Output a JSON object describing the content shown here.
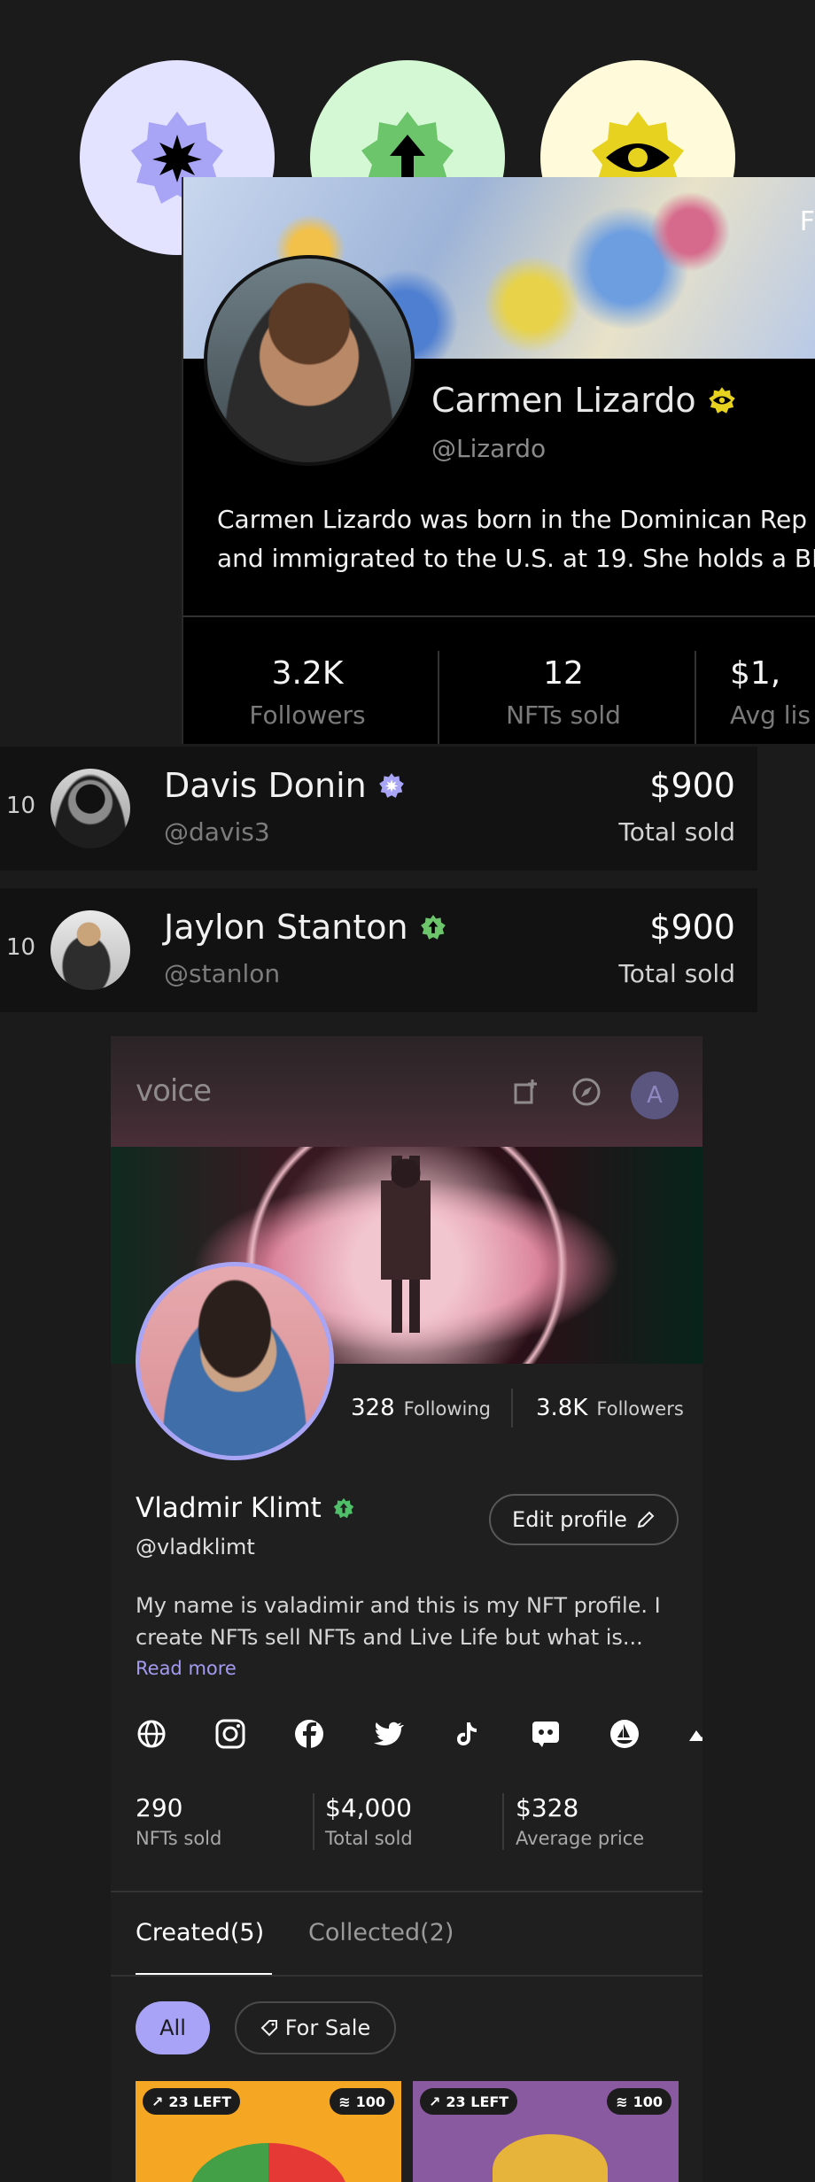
{
  "badges": [
    {
      "icon": "starburst-icon",
      "bg": "#e3e2ff",
      "fill": "#a9a5f6"
    },
    {
      "icon": "arrow-up-icon",
      "bg": "#d5f8d4",
      "fill": "#6cc46b"
    },
    {
      "icon": "eye-icon",
      "bg": "#fffad9",
      "fill": "#e6d21f"
    }
  ],
  "profile_card": {
    "name": "Carmen Lizardo",
    "handle": "@Lizardo",
    "bio_line1": "Carmen Lizardo was born in the Dominican Rep",
    "bio_line2": "and immigrated to the U.S. at 19. She holds a BF",
    "edge_text": "F",
    "stats": [
      {
        "value": "3.2K",
        "label": "Followers"
      },
      {
        "value": "12",
        "label": "NFTs sold"
      },
      {
        "value": "$1,",
        "label": "Avg lis"
      }
    ]
  },
  "leaderboard": [
    {
      "rank": "10",
      "name": "Davis Donin",
      "handle": "@davis3",
      "amount": "$900",
      "amount_label": "Total sold",
      "badge_color": "#a9a5f6"
    },
    {
      "rank": "10",
      "name": "Jaylon Stanton",
      "handle": "@stanlon",
      "amount": "$900",
      "amount_label": "Total sold",
      "badge_color": "#6cc46b"
    }
  ],
  "panel": {
    "logo": "voice",
    "avatar_letter": "A",
    "following_count": "328",
    "following_label": "Following",
    "followers_count": "3.8K",
    "followers_label": "Followers",
    "name": "Vladmir Klimt",
    "handle": "@vladklimt",
    "edit_label": "Edit profile",
    "bio_line1": "My name is valadimir and this is my NFT profile. I",
    "bio_line2": "create NFTs sell NFTs and Live Life but what is...",
    "read_more": "Read more",
    "socials": [
      "globe-icon",
      "instagram-icon",
      "facebook-icon",
      "twitter-icon",
      "tiktok-icon",
      "discord-icon",
      "opensea-icon",
      "more-icon"
    ],
    "stats": [
      {
        "value": "290",
        "label": "NFTs sold"
      },
      {
        "value": "$4,000",
        "label": "Total sold"
      },
      {
        "value": "$328",
        "label": "Average price"
      }
    ],
    "tabs": [
      {
        "label": "Created(5)",
        "active": true
      },
      {
        "label": "Collected(2)",
        "active": false
      }
    ],
    "filters": {
      "all": "All",
      "for_sale": "For Sale"
    },
    "nfts": [
      {
        "left_label": "23 LEFT",
        "right_label": "100",
        "bg": "#f5a623"
      },
      {
        "left_label": "23 LEFT",
        "right_label": "100",
        "bg": "#8a5aa0"
      }
    ],
    "accent": "#a8a3f6"
  }
}
